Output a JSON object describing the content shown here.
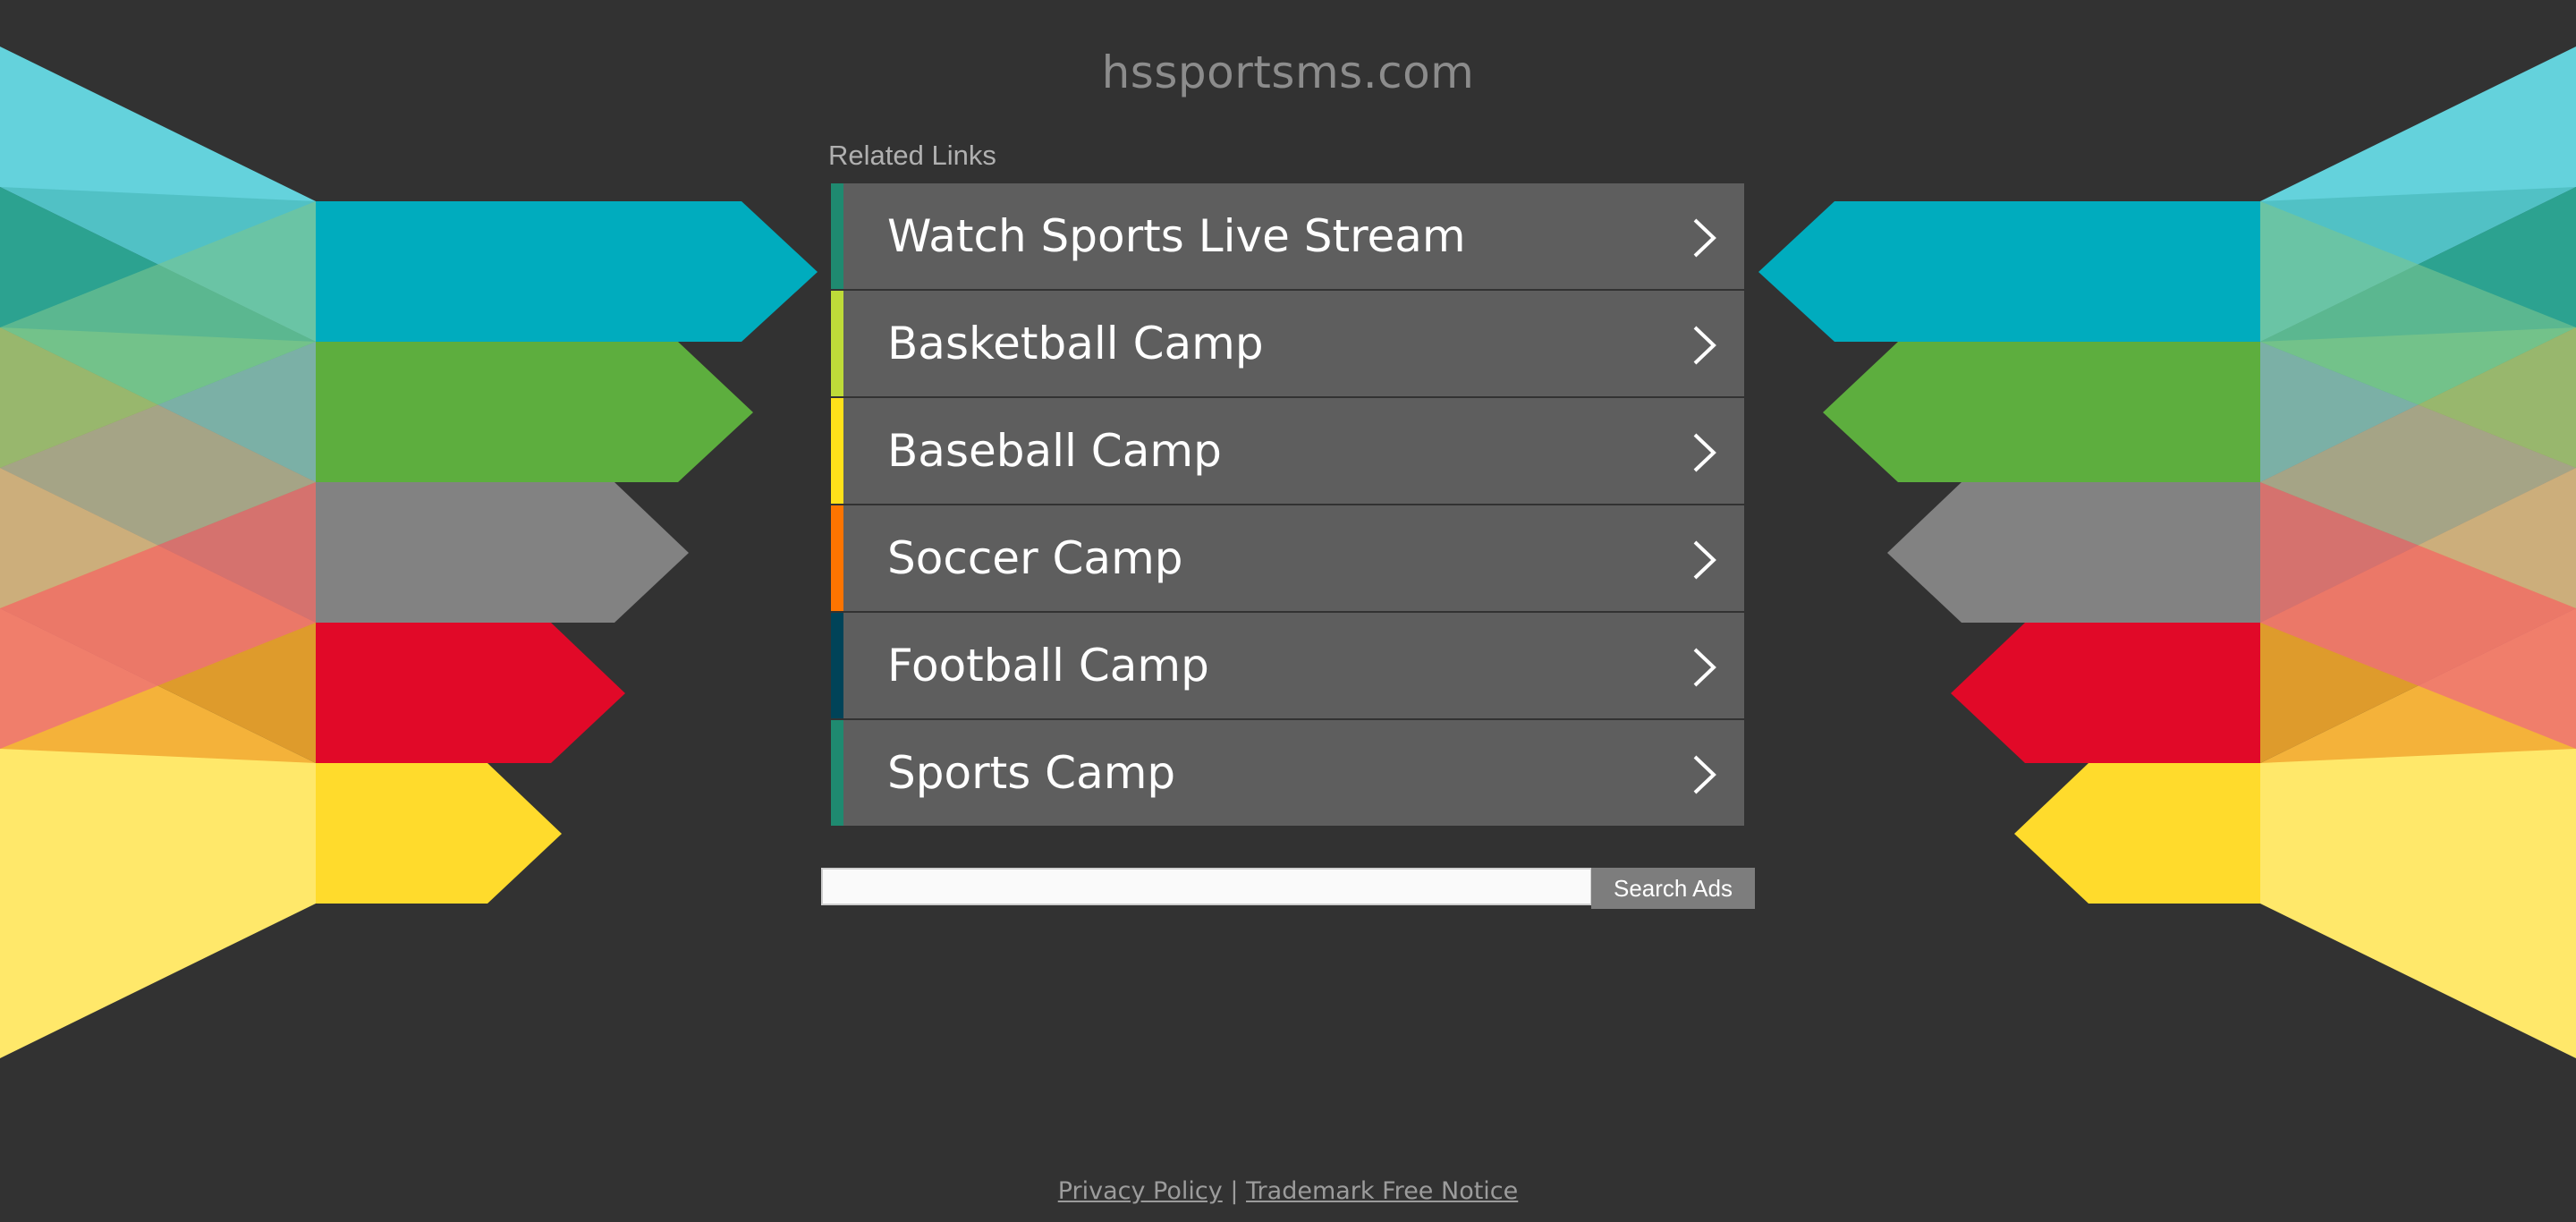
{
  "site": {
    "domain": "hssportsms.com"
  },
  "related": {
    "title": "Related Links",
    "links": [
      {
        "label": "Watch Sports Live Stream",
        "accent": "#1f8a70"
      },
      {
        "label": "Basketball Camp",
        "accent": "#bedb39"
      },
      {
        "label": "Baseball Camp",
        "accent": "#ffe11a"
      },
      {
        "label": "Soccer Camp",
        "accent": "#fd7400"
      },
      {
        "label": "Football Camp",
        "accent": "#004358"
      },
      {
        "label": "Sports Camp",
        "accent": "#1f8a70"
      }
    ]
  },
  "search": {
    "button_label": "Search Ads",
    "value": ""
  },
  "footer": {
    "privacy": "Privacy Policy",
    "separator": "|",
    "trademark": "Trademark Free Notice"
  },
  "decor": {
    "stripe_colors": [
      "#00acbe",
      "#5dae3e",
      "#828282",
      "#e10928",
      "#ffdb2c"
    ]
  }
}
